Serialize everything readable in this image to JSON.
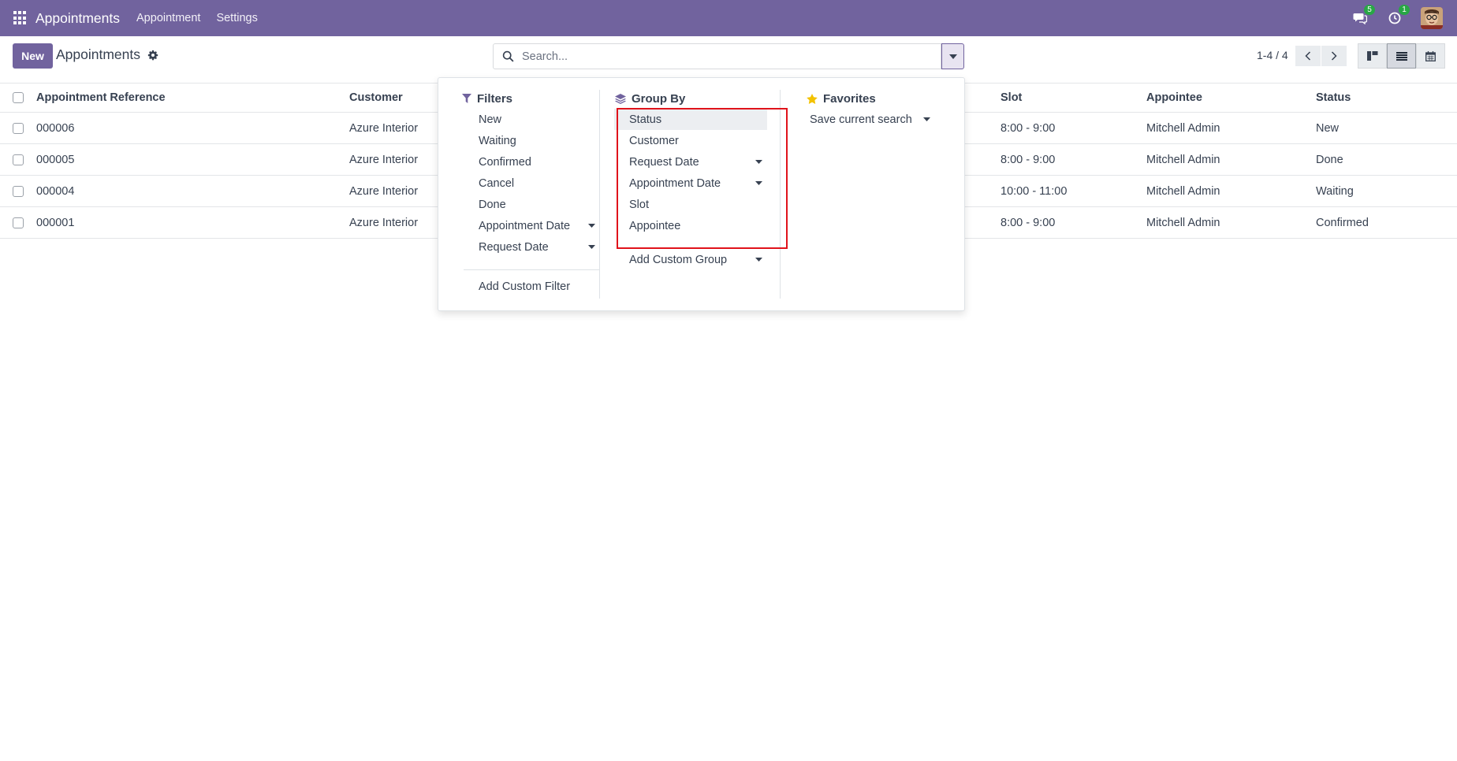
{
  "navbar": {
    "brand": "Appointments",
    "menu": [
      "Appointment",
      "Settings"
    ],
    "messages_count": "5",
    "activities_count": "1",
    "colors": {
      "navbar_bg": "#71639e",
      "badge": "#28a745"
    }
  },
  "control_panel": {
    "new_label": "New",
    "page_title": "Appointments",
    "search_placeholder": "Search...",
    "pager": "1-4 / 4"
  },
  "table": {
    "columns": [
      "Appointment Reference",
      "Customer",
      "Slot",
      "Appointee",
      "Status"
    ],
    "rows": [
      {
        "ref": "000006",
        "customer": "Azure Interior",
        "slot": "8:00 - 9:00",
        "appointee": "Mitchell Admin",
        "status": "New"
      },
      {
        "ref": "000005",
        "customer": "Azure Interior",
        "slot": "8:00 - 9:00",
        "appointee": "Mitchell Admin",
        "status": "Done"
      },
      {
        "ref": "000004",
        "customer": "Azure Interior",
        "slot": "10:00 - 11:00",
        "appointee": "Mitchell Admin",
        "status": "Waiting"
      },
      {
        "ref": "000001",
        "customer": "Azure Interior",
        "slot": "8:00 - 9:00",
        "appointee": "Mitchell Admin",
        "status": "Confirmed"
      }
    ]
  },
  "search_panel": {
    "filters": {
      "title": "Filters",
      "items": [
        "New",
        "Waiting",
        "Confirmed",
        "Cancel",
        "Done",
        "Appointment Date",
        "Request Date"
      ],
      "add_custom": "Add Custom Filter"
    },
    "group_by": {
      "title": "Group By",
      "items": [
        "Status",
        "Customer",
        "Request Date",
        "Appointment Date",
        "Slot",
        "Appointee"
      ],
      "add_custom": "Add Custom Group"
    },
    "favorites": {
      "title": "Favorites",
      "save_search": "Save current search"
    },
    "colors": {
      "highlight_box": "#e0131b",
      "star": "#f3c200"
    }
  }
}
